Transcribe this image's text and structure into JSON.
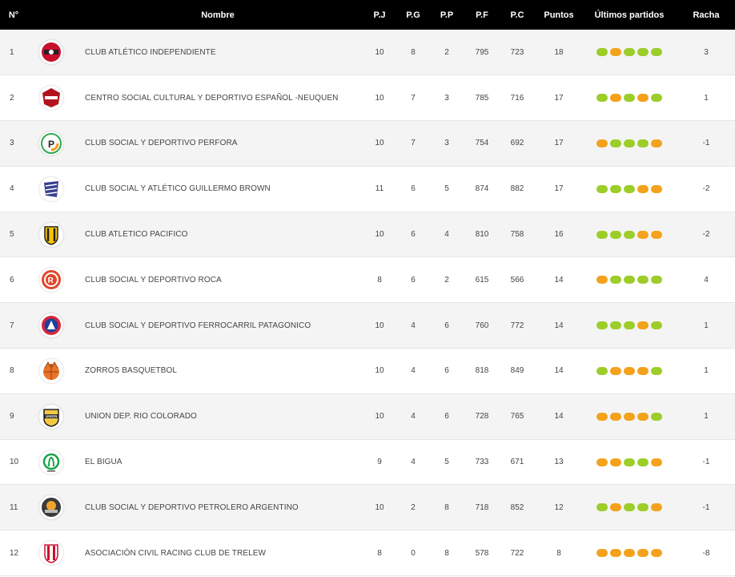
{
  "headers": {
    "pos": "N°",
    "name": "Nombre",
    "pj": "P.J",
    "pg": "P.G",
    "pp": "P.P",
    "pf": "P.F",
    "pc": "P.C",
    "puntos": "Puntos",
    "ultimos": "Últimos partidos",
    "racha": "Racha"
  },
  "colors": {
    "win": "#9ccd29",
    "loss": "#f4a21c",
    "header_bg": "#000000"
  },
  "rows": [
    {
      "pos": "1",
      "name": "CLUB ATLÉTICO INDEPENDIENTE",
      "logo": "independiente-logo",
      "pj": "10",
      "pg": "8",
      "pp": "2",
      "pf": "795",
      "pc": "723",
      "puntos": "18",
      "form": [
        "W",
        "L",
        "W",
        "W",
        "W"
      ],
      "racha": "3"
    },
    {
      "pos": "2",
      "name": "CENTRO SOCIAL CULTURAL Y DEPORTIVO ESPAÑOL -NEUQUEN",
      "logo": "espanol-logo",
      "pj": "10",
      "pg": "7",
      "pp": "3",
      "pf": "785",
      "pc": "716",
      "puntos": "17",
      "form": [
        "W",
        "L",
        "W",
        "L",
        "W"
      ],
      "racha": "1"
    },
    {
      "pos": "3",
      "name": "CLUB SOCIAL Y DEPORTIVO PERFORA",
      "logo": "perfora-logo",
      "pj": "10",
      "pg": "7",
      "pp": "3",
      "pf": "754",
      "pc": "692",
      "puntos": "17",
      "form": [
        "L",
        "W",
        "W",
        "W",
        "L"
      ],
      "racha": "-1"
    },
    {
      "pos": "4",
      "name": "CLUB SOCIAL Y ATLÉTICO GUILLERMO BROWN",
      "logo": "guillermo-brown-logo",
      "pj": "11",
      "pg": "6",
      "pp": "5",
      "pf": "874",
      "pc": "882",
      "puntos": "17",
      "form": [
        "W",
        "W",
        "W",
        "L",
        "L"
      ],
      "racha": "-2"
    },
    {
      "pos": "5",
      "name": "CLUB ATLETICO PACIFICO",
      "logo": "pacifico-logo",
      "pj": "10",
      "pg": "6",
      "pp": "4",
      "pf": "810",
      "pc": "758",
      "puntos": "16",
      "form": [
        "W",
        "W",
        "W",
        "L",
        "L"
      ],
      "racha": "-2"
    },
    {
      "pos": "6",
      "name": "CLUB SOCIAL Y DEPORTIVO ROCA",
      "logo": "roca-logo",
      "pj": "8",
      "pg": "6",
      "pp": "2",
      "pf": "615",
      "pc": "566",
      "puntos": "14",
      "form": [
        "L",
        "W",
        "W",
        "W",
        "W"
      ],
      "racha": "4"
    },
    {
      "pos": "7",
      "name": "CLUB SOCIAL Y DEPORTIVO FERROCARRIL PATAGONICO",
      "logo": "ferrocarril-logo",
      "pj": "10",
      "pg": "4",
      "pp": "6",
      "pf": "760",
      "pc": "772",
      "puntos": "14",
      "form": [
        "W",
        "W",
        "W",
        "L",
        "W"
      ],
      "racha": "1"
    },
    {
      "pos": "8",
      "name": "ZORROS BASQUETBOL",
      "logo": "zorros-logo",
      "pj": "10",
      "pg": "4",
      "pp": "6",
      "pf": "818",
      "pc": "849",
      "puntos": "14",
      "form": [
        "W",
        "L",
        "L",
        "L",
        "W"
      ],
      "racha": "1"
    },
    {
      "pos": "9",
      "name": "UNION DEP. RIO COLORADO",
      "logo": "union-logo",
      "pj": "10",
      "pg": "4",
      "pp": "6",
      "pf": "728",
      "pc": "765",
      "puntos": "14",
      "form": [
        "L",
        "L",
        "L",
        "L",
        "W"
      ],
      "racha": "1"
    },
    {
      "pos": "10",
      "name": "EL BIGUA",
      "logo": "bigua-logo",
      "pj": "9",
      "pg": "4",
      "pp": "5",
      "pf": "733",
      "pc": "671",
      "puntos": "13",
      "form": [
        "L",
        "L",
        "W",
        "W",
        "L"
      ],
      "racha": "-1"
    },
    {
      "pos": "11",
      "name": "CLUB SOCIAL Y DEPORTIVO PETROLERO ARGENTINO",
      "logo": "petrolero-logo",
      "pj": "10",
      "pg": "2",
      "pp": "8",
      "pf": "718",
      "pc": "852",
      "puntos": "12",
      "form": [
        "W",
        "L",
        "W",
        "W",
        "L"
      ],
      "racha": "-1"
    },
    {
      "pos": "12",
      "name": "ASOCIACIÓN CIVIL RACING CLUB DE TRELEW",
      "logo": "racing-trelew-logo",
      "pj": "8",
      "pg": "0",
      "pp": "8",
      "pf": "578",
      "pc": "722",
      "puntos": "8",
      "form": [
        "L",
        "L",
        "L",
        "L",
        "L"
      ],
      "racha": "-8"
    }
  ]
}
